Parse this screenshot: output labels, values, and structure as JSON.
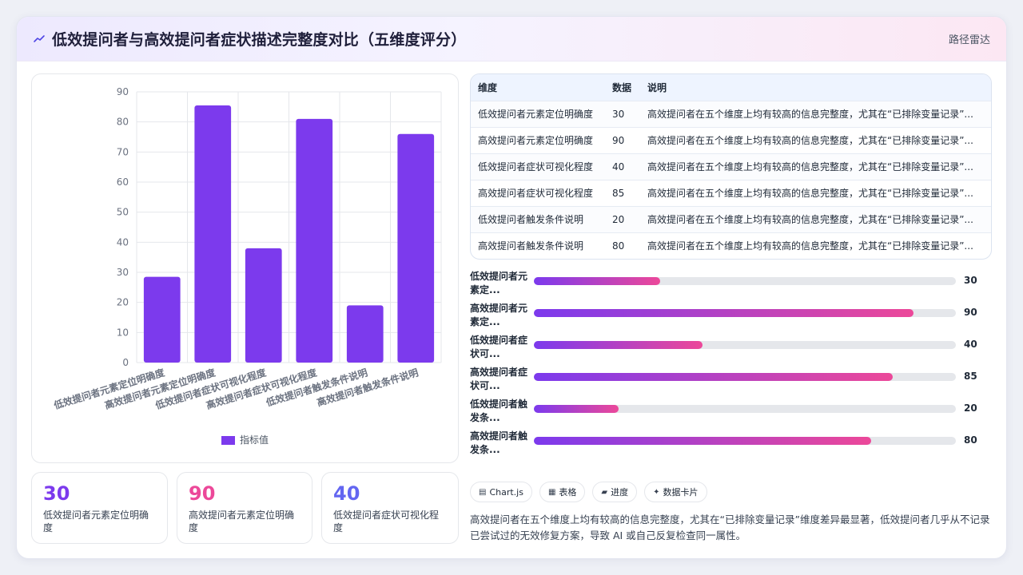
{
  "header": {
    "title": "低效提问者与高效提问者症状描述完整度对比（五维度评分）",
    "tag": "路径雷达"
  },
  "chart_data": {
    "type": "bar",
    "categories": [
      "低效提问者元素定位明确度",
      "高效提问者元素定位明确度",
      "低效提问者症状可视化程度",
      "高效提问者症状可视化程度",
      "低效提问者触发条件说明",
      "高效提问者触发条件说明"
    ],
    "series": [
      {
        "name": "指标值",
        "values": [
          28.5,
          85.5,
          38,
          81,
          19,
          76
        ]
      }
    ],
    "ylim": [
      0,
      90
    ],
    "yticks": [
      0,
      10,
      20,
      30,
      40,
      50,
      60,
      70,
      80,
      90
    ],
    "grid": true,
    "legend": "bottom",
    "color": "#7c3aed"
  },
  "stats": [
    {
      "value": "30",
      "label": "低效提问者元素定位明确度",
      "color": "#7c3aed"
    },
    {
      "value": "90",
      "label": "高效提问者元素定位明确度",
      "color": "#ec4899"
    },
    {
      "value": "40",
      "label": "低效提问者症状可视化程度",
      "color": "#6366f1"
    }
  ],
  "table": {
    "headers": [
      "维度",
      "数据",
      "说明"
    ],
    "rows": [
      [
        "低效提问者元素定位明确度",
        "30",
        "高效提问者在五个维度上均有较高的信息完整度，尤其在“已排除变量记录”..."
      ],
      [
        "高效提问者元素定位明确度",
        "90",
        "高效提问者在五个维度上均有较高的信息完整度，尤其在“已排除变量记录”..."
      ],
      [
        "低效提问者症状可视化程度",
        "40",
        "高效提问者在五个维度上均有较高的信息完整度，尤其在“已排除变量记录”..."
      ],
      [
        "高效提问者症状可视化程度",
        "85",
        "高效提问者在五个维度上均有较高的信息完整度，尤其在“已排除变量记录”..."
      ],
      [
        "低效提问者触发条件说明",
        "20",
        "高效提问者在五个维度上均有较高的信息完整度，尤其在“已排除变量记录”..."
      ],
      [
        "高效提问者触发条件说明",
        "80",
        "高效提问者在五个维度上均有较高的信息完整度，尤其在“已排除变量记录”..."
      ]
    ]
  },
  "progress": [
    {
      "label": "低效提问者元素定...",
      "value": "30",
      "percent": 30
    },
    {
      "label": "高效提问者元素定...",
      "value": "90",
      "percent": 90
    },
    {
      "label": "低效提问者症状可...",
      "value": "40",
      "percent": 40
    },
    {
      "label": "高效提问者症状可...",
      "value": "85",
      "percent": 85
    },
    {
      "label": "低效提问者触发条...",
      "value": "20",
      "percent": 20
    },
    {
      "label": "高效提问者触发条...",
      "value": "80",
      "percent": 80
    }
  ],
  "chips": [
    {
      "icon": "▤",
      "label": "Chart.js"
    },
    {
      "icon": "▦",
      "label": "表格"
    },
    {
      "icon": "▰",
      "label": "进度"
    },
    {
      "icon": "✦",
      "label": "数据卡片"
    }
  ],
  "summary": "高效提问者在五个维度上均有较高的信息完整度，尤其在“已排除变量记录”维度差异最显著，低效提问者几乎从不记录已尝试过的无效修复方案，导致 AI 或自己反复检查同一属性。"
}
